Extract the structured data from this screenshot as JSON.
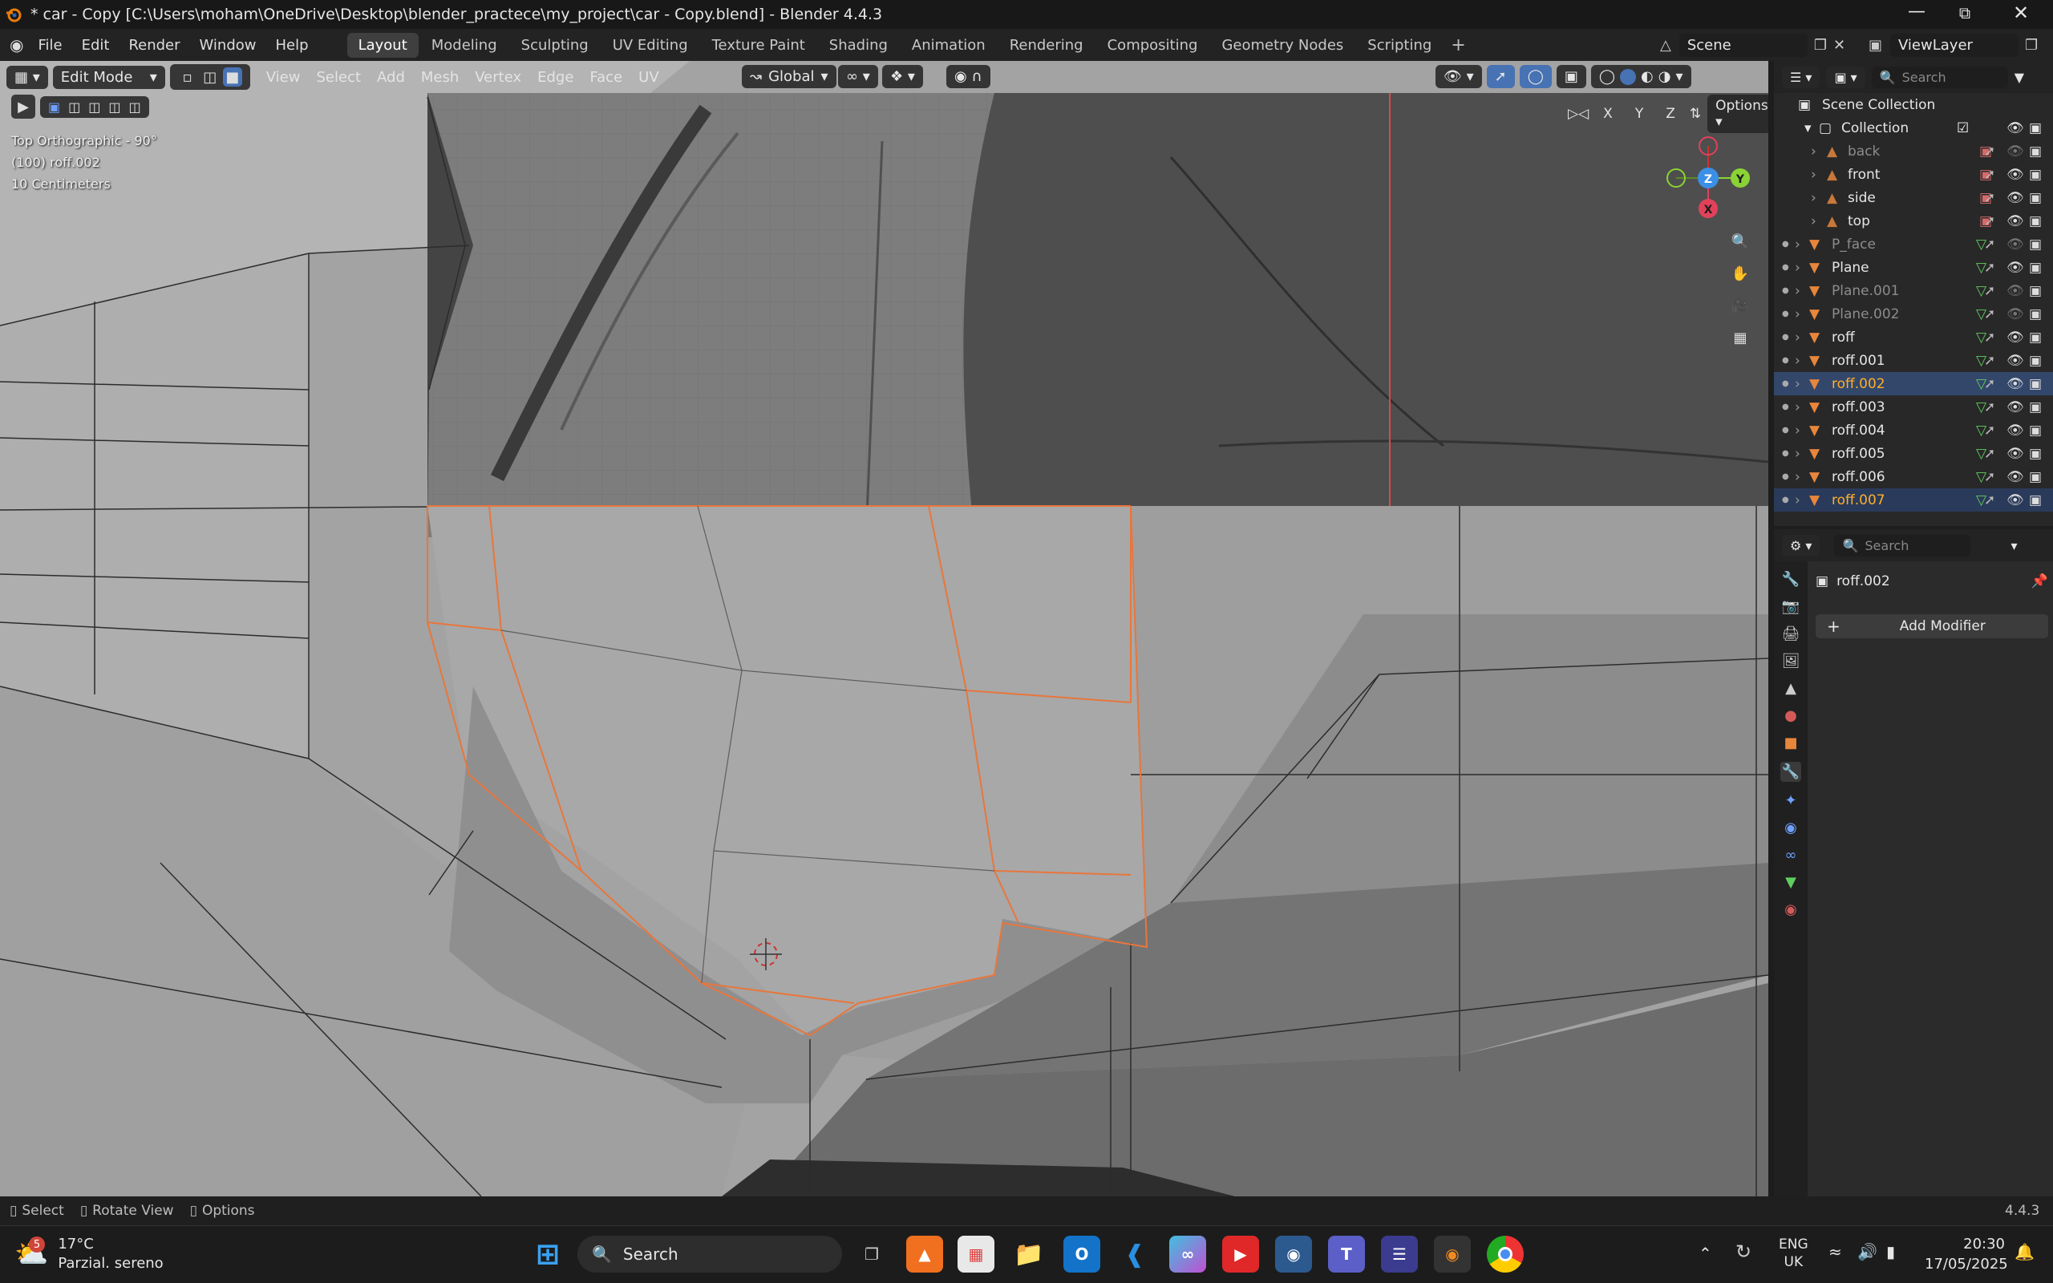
{
  "window": {
    "title": "* car - Copy [C:\\Users\\moham\\OneDrive\\Desktop\\blender_practece\\my_project\\car - Copy.blend] - Blender 4.4.3"
  },
  "menus": [
    "File",
    "Edit",
    "Render",
    "Window",
    "Help"
  ],
  "workspaces": [
    "Layout",
    "Modeling",
    "Sculpting",
    "UV Editing",
    "Texture Paint",
    "Shading",
    "Animation",
    "Rendering",
    "Compositing",
    "Geometry Nodes",
    "Scripting"
  ],
  "active_workspace": "Layout",
  "scene": "Scene",
  "view_layer": "ViewLayer",
  "viewport": {
    "mode": "Edit Mode",
    "header_menus": [
      "View",
      "Select",
      "Add",
      "Mesh",
      "Vertex",
      "Edge",
      "Face",
      "UV"
    ],
    "transform_orientation": "Global",
    "options_label": "Options",
    "axis_labels": [
      "X",
      "Y",
      "Z"
    ],
    "info_view": "Top Orthographic - 90°",
    "info_object": "(100) roff.002",
    "info_scale": "10 Centimeters",
    "gizmo": {
      "x": "X",
      "y": "Y",
      "z": "Z"
    }
  },
  "outliner": {
    "search_placeholder": "Search",
    "root": "Scene Collection",
    "collection": "Collection",
    "items": [
      {
        "name": "back",
        "type": "image"
      },
      {
        "name": "front",
        "type": "image"
      },
      {
        "name": "side",
        "type": "image"
      },
      {
        "name": "top",
        "type": "image"
      },
      {
        "name": "P_face",
        "type": "mesh"
      },
      {
        "name": "Plane",
        "type": "mesh"
      },
      {
        "name": "Plane.001",
        "type": "mesh"
      },
      {
        "name": "Plane.002",
        "type": "mesh"
      },
      {
        "name": "roff",
        "type": "mesh"
      },
      {
        "name": "roff.001",
        "type": "mesh"
      },
      {
        "name": "roff.002",
        "type": "mesh"
      },
      {
        "name": "roff.003",
        "type": "mesh"
      },
      {
        "name": "roff.004",
        "type": "mesh"
      },
      {
        "name": "roff.005",
        "type": "mesh"
      },
      {
        "name": "roff.006",
        "type": "mesh"
      },
      {
        "name": "roff.007",
        "type": "mesh"
      }
    ]
  },
  "properties": {
    "search_placeholder": "Search",
    "object_name": "roff.002",
    "add_modifier": "Add Modifier"
  },
  "statusbar": {
    "select": "Select",
    "rotate": "Rotate View",
    "options": "Options",
    "version": "4.4.3"
  },
  "taskbar": {
    "weather_badge": "5",
    "temperature": "17°C",
    "weather": "Parzial. sereno",
    "search": "Search",
    "lang_top": "ENG",
    "lang_bottom": "UK",
    "time": "20:30",
    "date": "17/05/2025"
  },
  "colors": {
    "accent_blue": "#4772b3",
    "selection_orange": "#e8763c",
    "x_axis": "#e2415a",
    "y_axis": "#8ad335",
    "z_axis": "#3b8fe6"
  }
}
